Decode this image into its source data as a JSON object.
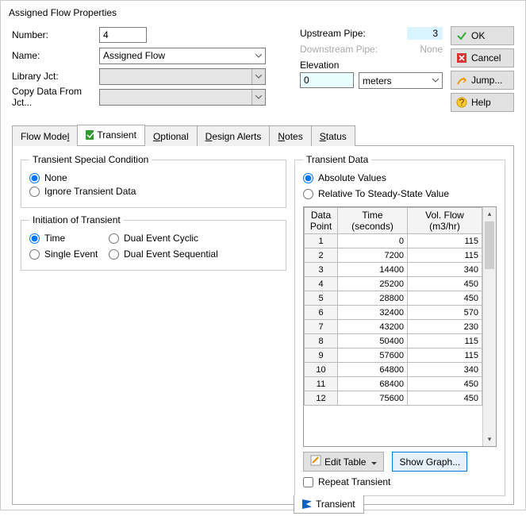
{
  "title": "Assigned Flow Properties",
  "form": {
    "number_label": "Number:",
    "number_value": "4",
    "name_label": "Name:",
    "name_value": "Assigned Flow",
    "library_label": "Library Jct:",
    "copy_label": "Copy Data From Jct..."
  },
  "pipes": {
    "upstream_label": "Upstream Pipe:",
    "upstream_value": "3",
    "downstream_label": "Downstream Pipe:",
    "downstream_value": "None",
    "elevation_label": "Elevation",
    "elevation_value": "0",
    "elevation_units": "meters"
  },
  "buttons": {
    "ok": "OK",
    "cancel": "Cancel",
    "jump": "Jump...",
    "help": "Help"
  },
  "tabs": {
    "flowmodel": "Flow Model",
    "transient": "Transient",
    "optional": "Optional",
    "design": "Design Alerts",
    "notes": "Notes",
    "status": "Status"
  },
  "panel": {
    "special_title": "Transient Special Condition",
    "none": "None",
    "ignore": "Ignore Transient Data",
    "init_title": "Initiation of Transient",
    "time": "Time",
    "single": "Single Event",
    "dual_cyclic": "Dual Event Cyclic",
    "dual_seq": "Dual Event Sequential",
    "data_title": "Transient Data",
    "absolute": "Absolute Values",
    "relative": "Relative To Steady-State Value",
    "col_point": "Data Point",
    "col_time": "Time (seconds)",
    "col_flow": "Vol. Flow (m3/hr)",
    "edit_table": "Edit Table",
    "show_graph": "Show Graph...",
    "repeat": "Repeat Transient",
    "sub_transient": "Transient"
  },
  "table_rows": [
    {
      "n": "1",
      "t": "0",
      "v": "115"
    },
    {
      "n": "2",
      "t": "7200",
      "v": "115"
    },
    {
      "n": "3",
      "t": "14400",
      "v": "340"
    },
    {
      "n": "4",
      "t": "25200",
      "v": "450"
    },
    {
      "n": "5",
      "t": "28800",
      "v": "450"
    },
    {
      "n": "6",
      "t": "32400",
      "v": "570"
    },
    {
      "n": "7",
      "t": "43200",
      "v": "230"
    },
    {
      "n": "8",
      "t": "50400",
      "v": "115"
    },
    {
      "n": "9",
      "t": "57600",
      "v": "115"
    },
    {
      "n": "10",
      "t": "64800",
      "v": "340"
    },
    {
      "n": "11",
      "t": "68400",
      "v": "450"
    },
    {
      "n": "12",
      "t": "75600",
      "v": "450"
    }
  ]
}
